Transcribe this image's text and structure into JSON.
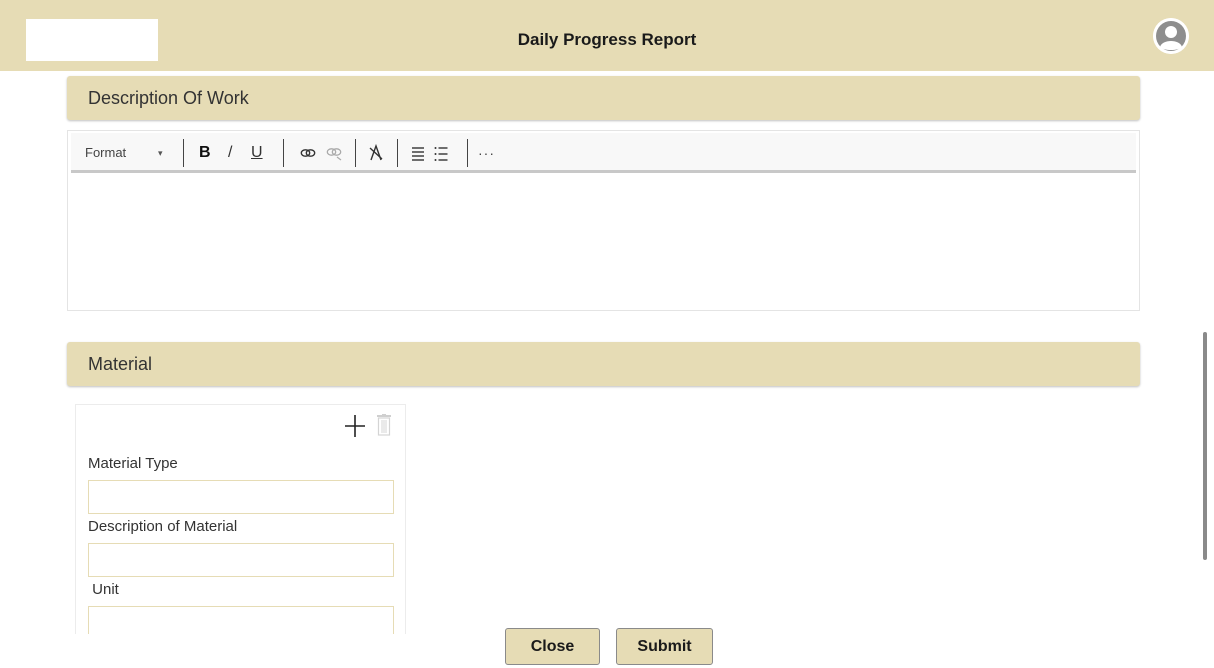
{
  "header": {
    "title": "Daily Progress Report",
    "avatar_icon": "user-avatar-icon",
    "background": "#e6dcb5"
  },
  "description_section": {
    "title": "Description Of Work",
    "editor": {
      "format_label": "Format",
      "toolbar_icons": [
        "chevron-down-icon",
        "bold-icon",
        "italic-icon",
        "underline-icon",
        "link-icon",
        "unlink-icon",
        "clear-format-icon",
        "bullet-list-icon",
        "numbered-list-icon",
        "more-icon"
      ],
      "bold_label": "B",
      "italic_label": "/",
      "underline_label": "U",
      "more_label": "···",
      "content": ""
    }
  },
  "material_section": {
    "title": "Material",
    "card": {
      "add_icon": "plus-icon",
      "delete_icon": "trash-icon",
      "fields": [
        {
          "label": "Material Type",
          "value": ""
        },
        {
          "label": "Description of Material",
          "value": ""
        },
        {
          "label": " Unit",
          "value": ""
        }
      ]
    }
  },
  "footer": {
    "close_label": "Close",
    "submit_label": "Submit"
  },
  "colors": {
    "accent": "#e6dcb5",
    "input_border": "#e6dcb5"
  }
}
